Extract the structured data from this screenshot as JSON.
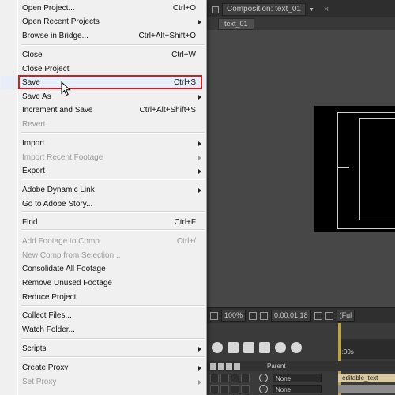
{
  "composition": {
    "tab_title": "Composition: text_01",
    "dropdown_glyph": "▼",
    "close_glyph": "×",
    "sub_tab": "text_01"
  },
  "viewer_toolbar": {
    "zoom": "100%",
    "timecode": "0:00:01:18",
    "overflow": "(Ful"
  },
  "timeline": {
    "ruler_label": "):00s",
    "parent_header": "Parent",
    "rows": [
      {
        "parent": "None",
        "layer": "editable_text"
      },
      {
        "parent": "None",
        "layer": ""
      }
    ]
  },
  "file_menu": {
    "items": [
      {
        "label": "Open Project...",
        "shortcut": "Ctrl+O",
        "submenu": false,
        "disabled": false
      },
      {
        "label": "Open Recent Projects",
        "shortcut": "",
        "submenu": true,
        "disabled": false
      },
      {
        "label": "Browse in Bridge...",
        "shortcut": "Ctrl+Alt+Shift+O",
        "submenu": false,
        "disabled": false
      },
      {
        "label": "Close",
        "shortcut": "Ctrl+W",
        "submenu": false,
        "disabled": false
      },
      {
        "label": "Close Project",
        "shortcut": "",
        "submenu": false,
        "disabled": false
      },
      {
        "label": "Save",
        "shortcut": "Ctrl+S",
        "submenu": false,
        "disabled": false,
        "highlighted": true
      },
      {
        "label": "Save As",
        "shortcut": "",
        "submenu": true,
        "disabled": false
      },
      {
        "label": "Increment and Save",
        "shortcut": "Ctrl+Alt+Shift+S",
        "submenu": false,
        "disabled": false
      },
      {
        "label": "Revert",
        "shortcut": "",
        "submenu": false,
        "disabled": true
      },
      {
        "label": "Import",
        "shortcut": "",
        "submenu": true,
        "disabled": false
      },
      {
        "label": "Import Recent Footage",
        "shortcut": "",
        "submenu": true,
        "disabled": true
      },
      {
        "label": "Export",
        "shortcut": "",
        "submenu": true,
        "disabled": false
      },
      {
        "label": "Adobe Dynamic Link",
        "shortcut": "",
        "submenu": true,
        "disabled": false
      },
      {
        "label": "Go to Adobe Story...",
        "shortcut": "",
        "submenu": false,
        "disabled": false
      },
      {
        "label": "Find",
        "shortcut": "Ctrl+F",
        "submenu": false,
        "disabled": false
      },
      {
        "label": "Add Footage to Comp",
        "shortcut": "Ctrl+/",
        "submenu": false,
        "disabled": true
      },
      {
        "label": "New Comp from Selection...",
        "shortcut": "",
        "submenu": false,
        "disabled": true
      },
      {
        "label": "Consolidate All Footage",
        "shortcut": "",
        "submenu": false,
        "disabled": false
      },
      {
        "label": "Remove Unused Footage",
        "shortcut": "",
        "submenu": false,
        "disabled": false
      },
      {
        "label": "Reduce Project",
        "shortcut": "",
        "submenu": false,
        "disabled": false
      },
      {
        "label": "Collect Files...",
        "shortcut": "",
        "submenu": false,
        "disabled": false
      },
      {
        "label": "Watch Folder...",
        "shortcut": "",
        "submenu": false,
        "disabled": false
      },
      {
        "label": "Scripts",
        "shortcut": "",
        "submenu": true,
        "disabled": false
      },
      {
        "label": "Create Proxy",
        "shortcut": "",
        "submenu": true,
        "disabled": false
      },
      {
        "label": "Set Proxy",
        "shortcut": "",
        "submenu": true,
        "disabled": true
      }
    ]
  },
  "colors": {
    "highlight_box": "#d21e1e",
    "menu_background": "#f0f0f0",
    "viewer_background": "#474747",
    "layer_bar": "#d9c9a1"
  }
}
